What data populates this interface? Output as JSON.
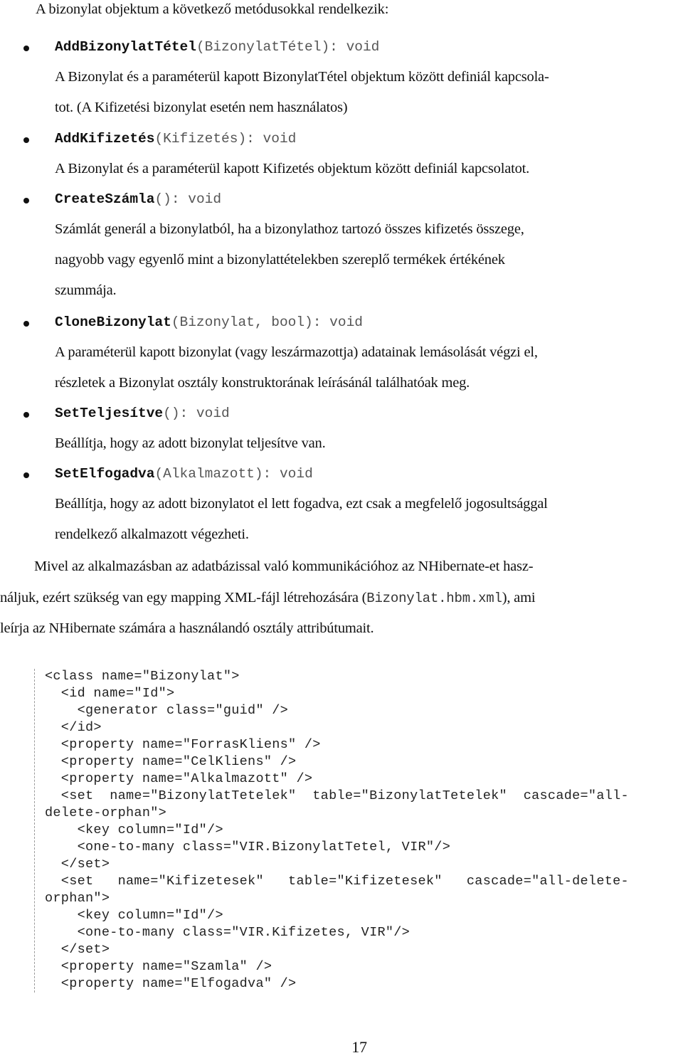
{
  "intro": "A bizonylat objektum a következő metódusokkal rendelkezik:",
  "methods": [
    {
      "name": "AddBizonylatTétel",
      "signature": "(BizonylatTétel): void",
      "description": [
        "A Bizonylat és a paraméterül kapott BizonylatTétel objektum között definiál kapcsola-",
        "tot. (A Kifizetési bizonylat esetén nem használatos)"
      ]
    },
    {
      "name": "AddKifizetés",
      "signature": "(Kifizetés): void",
      "description": [
        "A Bizonylat és a paraméterül kapott Kifizetés objektum között definiál kapcsolatot."
      ]
    },
    {
      "name": "CreateSzámla",
      "signature": "(): void",
      "description": [
        "Számlát generál a bizonylatból,  ha a bizonylathoz tartozó összes kifizetés összege,",
        "nagyobb vagy egyenlő mint a bizonylattételekben szereplő termékek értékének",
        "szummája."
      ]
    },
    {
      "name": "CloneBizonylat",
      "signature": "(Bizonylat, bool): void",
      "description": [
        "A paraméterül kapott bizonylat (vagy leszármazottja) adatainak lemásolását végzi el,",
        "részletek a Bizonylat osztály konstruktorának leírásánál találhatóak meg."
      ]
    },
    {
      "name": "SetTeljesítve",
      "signature": "(): void",
      "description": [
        "Beállítja, hogy az adott bizonylat teljesítve van."
      ]
    },
    {
      "name": "SetElfogadva",
      "signature": "(Alkalmazott): void",
      "description": [
        "Beállítja, hogy az adott bizonylatot el lett fogadva, ezt csak a megfelelő jogosultsággal",
        "rendelkező alkalmazott végezheti."
      ]
    }
  ],
  "paragraph": {
    "line1": "Mivel az alkalmazásban az adatbázissal való kommunikációhoz az NHibernate-et hasz-",
    "line2_before": "náljuk, ezért szükség van egy mapping XML-fájl létrehozására (",
    "line2_code": "Bizonylat.hbm.xml",
    "line2_after": "), ami",
    "line3": "leírja az NHibernate számára a használandó osztály attribútumait."
  },
  "code_lines": [
    "<class name=\"Bizonylat\">",
    "  <id name=\"Id\">",
    "    <generator class=\"guid\" />",
    "  </id>",
    "  <property name=\"ForrasKliens\" />",
    "  <property name=\"CelKliens\" />",
    "  <property name=\"Alkalmazott\" />",
    "  <set  name=\"BizonylatTetelek\"  table=\"BizonylatTetelek\"  cascade=\"all-",
    "delete-orphan\">",
    "    <key column=\"Id\"/>",
    "    <one-to-many class=\"VIR.BizonylatTetel, VIR\"/>",
    "  </set>",
    "  <set   name=\"Kifizetesek\"   table=\"Kifizetesek\"   cascade=\"all-delete-",
    "orphan\">",
    "    <key column=\"Id\"/>",
    "    <one-to-many class=\"VIR.Kifizetes, VIR\"/>",
    "  </set>",
    "  <property name=\"Szamla\" />",
    "  <property name=\"Elfogadva\" />"
  ],
  "page_number": "17"
}
